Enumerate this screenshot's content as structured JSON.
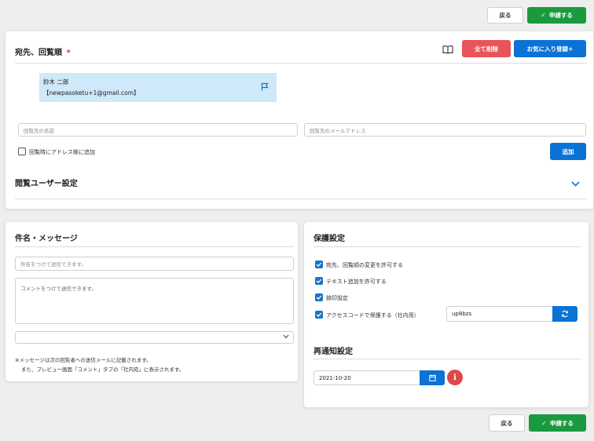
{
  "header": {
    "back_label": "戻る",
    "apply_label": "申請する"
  },
  "recipients": {
    "title": "宛先、回覧順",
    "required_mark": "*",
    "delete_all_label": "全て削除",
    "favorite_label": "お気に入り登録+",
    "entry": {
      "name": "鈴木 二郎",
      "email": "【newpasoketu+1@gmail.com】"
    },
    "name_placeholder": "回覧先の名前",
    "email_placeholder": "回覧先のメールアドレス",
    "add_to_addressbook_label": "回覧時にアドレス帳に追加",
    "add_label": "追加",
    "viewer_settings_title": "閲覧ユーザー設定"
  },
  "message": {
    "title": "件名・メッセージ",
    "subject_placeholder": "件名をつけて送信できます。",
    "comment_placeholder": "コメントをつけて送信できます。",
    "note_line1": "※メッセージは次の回覧者への送信メールに記載されます。",
    "note_line2": "また、プレビュー画面「コメント」タブの「社内宛」に表示されます。"
  },
  "protection": {
    "title": "保護設定",
    "options": [
      {
        "label": "宛先、回覧順の変更を許可する",
        "checked": true
      },
      {
        "label": "テキスト追加を許可する",
        "checked": true
      },
      {
        "label": "捺印設定",
        "checked": true
      },
      {
        "label": "アクセスコードで保護する（社内用）",
        "checked": true
      }
    ],
    "access_code": "up8bzs"
  },
  "renotify": {
    "title": "再通知設定",
    "date": "2021-10-20"
  },
  "footer": {
    "back_label": "戻る",
    "apply_label": "申請する"
  },
  "colors": {
    "green": "#1a9a3e",
    "blue": "#0b72d6",
    "red": "#e8545a",
    "highlight": "#cfe8fa"
  }
}
